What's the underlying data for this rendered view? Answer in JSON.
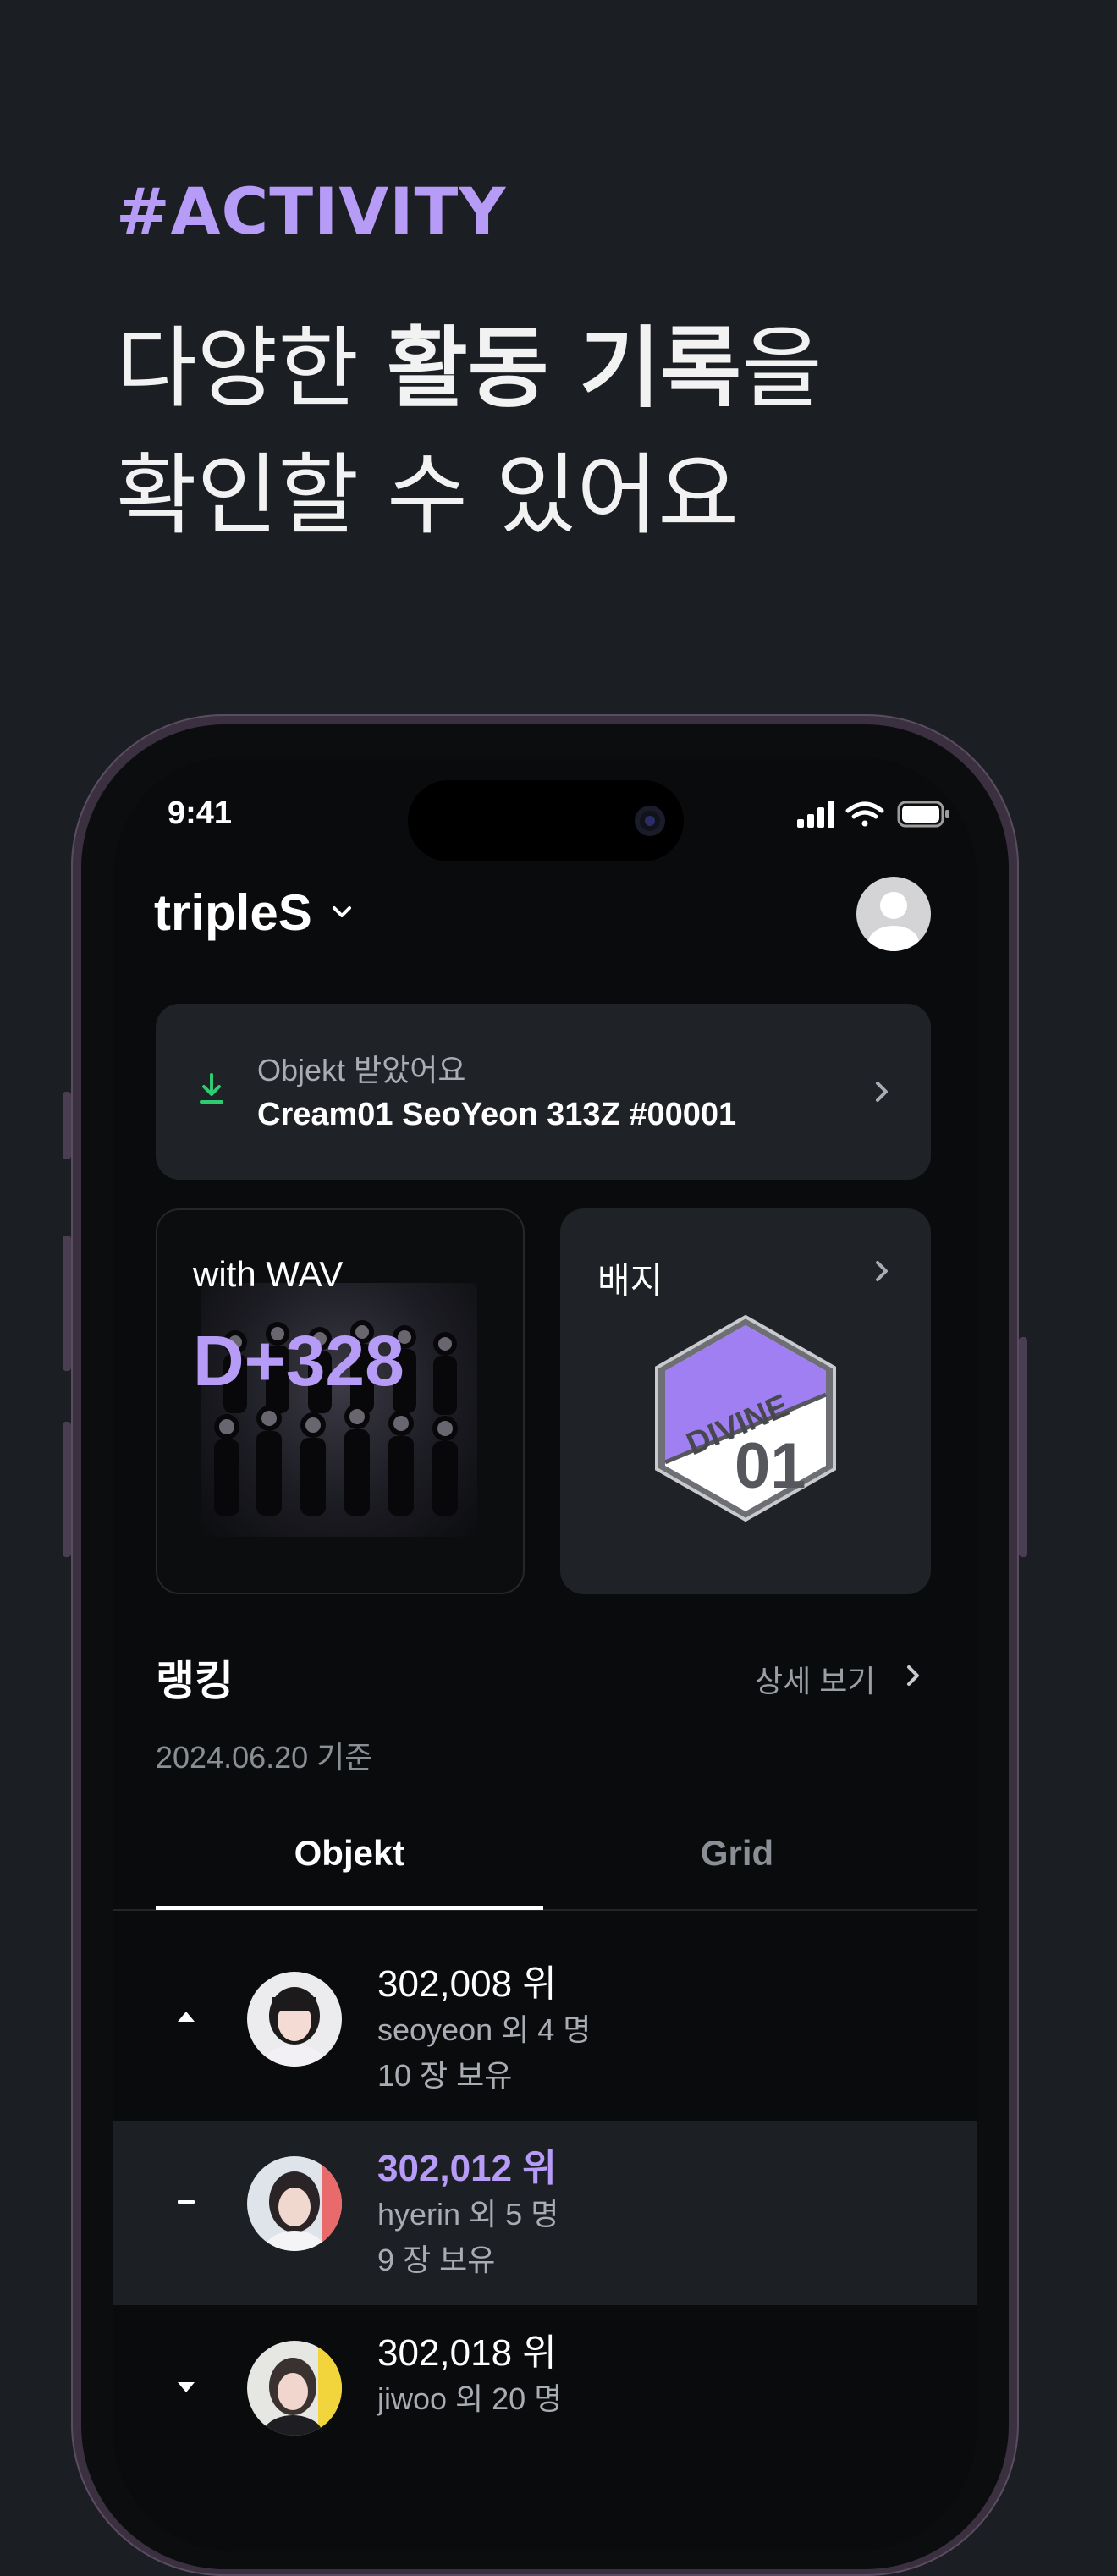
{
  "promo": {
    "tag": "#ACTIVITY",
    "headline_line1_pre": "다양한 ",
    "headline_line1_bold": "활동 기록",
    "headline_line1_post": "을",
    "headline_line2": "확인할 수 있어요"
  },
  "status_bar": {
    "time": "9:41",
    "icons": [
      "cellular-signal-icon",
      "wifi-icon",
      "battery-icon"
    ]
  },
  "header": {
    "title": "tripleS",
    "dropdown_icon": "chevron-down-icon",
    "profile_icon": "user-avatar-icon"
  },
  "notice": {
    "icon": "download-icon",
    "subtitle": "Objekt 받았어요",
    "title": "Cream01 SeoYeon 313Z #00001"
  },
  "wav_card": {
    "label": "with WAV",
    "dday": "D+328"
  },
  "badge_card": {
    "label": "배지",
    "badge_text_top": "DIVINE",
    "badge_text_bottom": "01"
  },
  "ranking": {
    "title": "랭킹",
    "more_label": "상세 보기",
    "date": "2024.06.20 기준",
    "tabs": [
      {
        "label": "Objekt",
        "active": true
      },
      {
        "label": "Grid",
        "active": false
      }
    ],
    "rows": [
      {
        "trend": "up",
        "rank": "302,008 위",
        "who": "seoyeon 외 4 명",
        "count": "10 장 보유",
        "highlight": false
      },
      {
        "trend": "same",
        "rank": "302,012 위",
        "who": "hyerin 외 5 명",
        "count": "9 장 보유",
        "highlight": true
      },
      {
        "trend": "down",
        "rank": "302,018 위",
        "who": "jiwoo 외 20 명",
        "count": "",
        "highlight": false
      }
    ]
  },
  "colors": {
    "accent": "#b79cf7",
    "background": "#1b1e23",
    "card": "#1f2226",
    "download_green": "#2ecc71"
  }
}
